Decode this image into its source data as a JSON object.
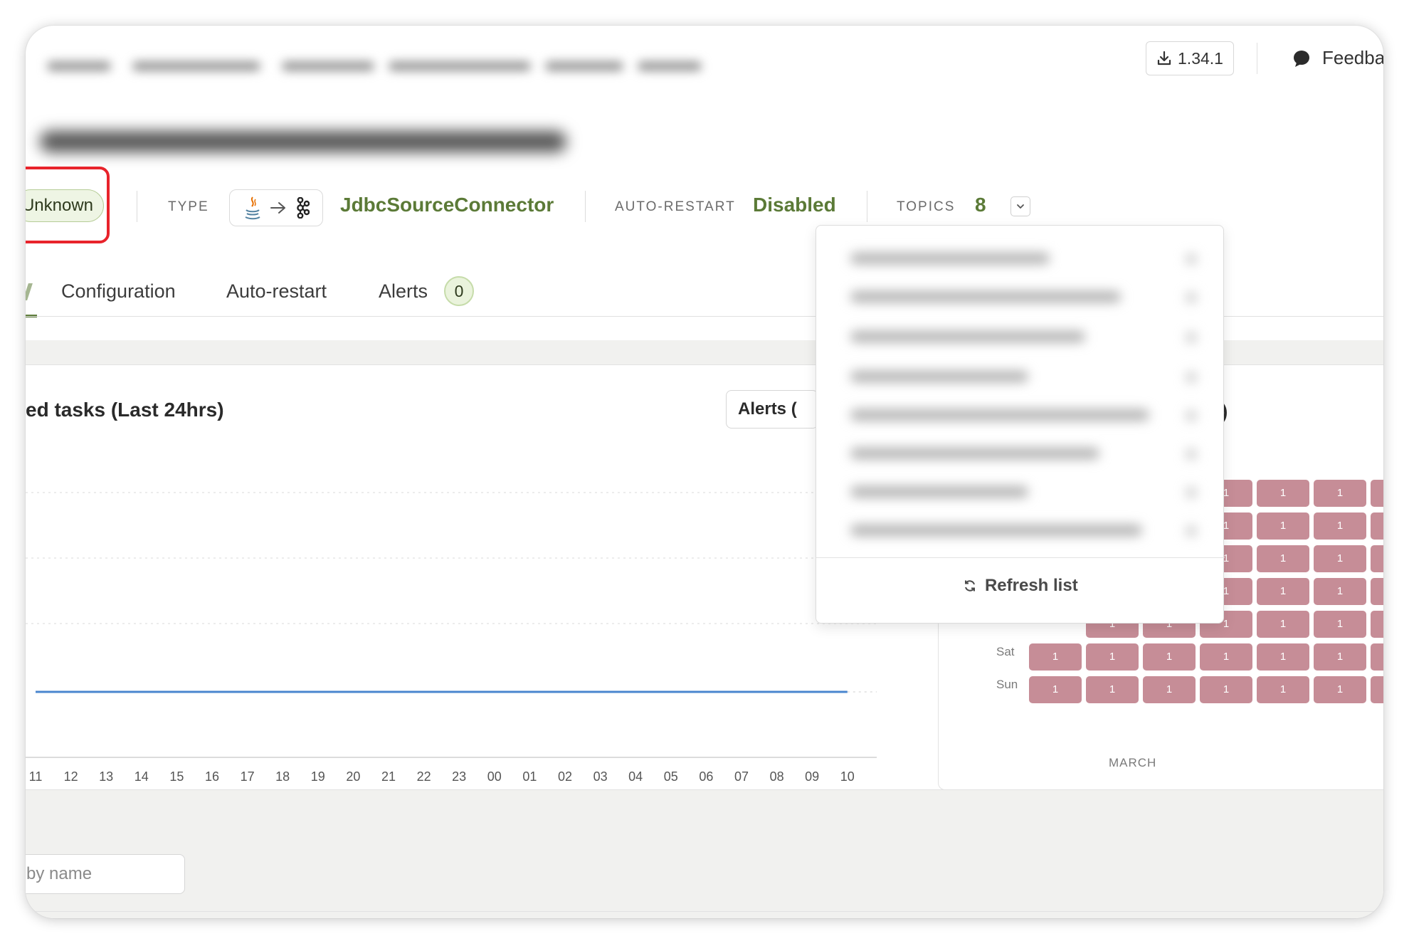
{
  "header": {
    "version": "1.34.1",
    "feedback_label": "Feedba"
  },
  "status": {
    "state": "Unknown",
    "type_label": "TYPE",
    "connector_class": "JdbcSourceConnector",
    "auto_restart_label": "AUTO-RESTART",
    "auto_restart_value": "Disabled",
    "topics_label": "TOPICS",
    "topics_count": "8"
  },
  "tabs": [
    {
      "label": "Configuration"
    },
    {
      "label": "Auto-restart"
    },
    {
      "label": "Alerts",
      "badge": "0"
    }
  ],
  "chart_card": {
    "title": "ed tasks (Last 24hrs)",
    "filter_label": "Alerts (",
    "hours": [
      "11",
      "12",
      "13",
      "14",
      "15",
      "16",
      "17",
      "18",
      "19",
      "20",
      "21",
      "22",
      "23",
      "00",
      "01",
      "02",
      "03",
      "04",
      "05",
      "06",
      "07",
      "08",
      "09",
      "10"
    ]
  },
  "chart_data": {
    "type": "line",
    "x": [
      "11",
      "12",
      "13",
      "14",
      "15",
      "16",
      "17",
      "18",
      "19",
      "20",
      "21",
      "22",
      "23",
      "00",
      "01",
      "02",
      "03",
      "04",
      "05",
      "06",
      "07",
      "08",
      "09",
      "10"
    ],
    "series": [
      {
        "values": [
          0,
          0,
          0,
          0,
          0,
          0,
          0,
          0,
          0,
          0,
          0,
          0,
          0,
          0,
          0,
          0,
          0,
          0,
          0,
          0,
          0,
          0,
          0,
          0
        ]
      }
    ],
    "grid": "horizontal dotted",
    "colors": {
      "line": "#4a86cf"
    }
  },
  "heatmap_card": {
    "title_tail": ")",
    "days": [
      "Sat",
      "Sun"
    ],
    "cell_value": "1",
    "month": "MARCH",
    "cell_color": "#c68d97"
  },
  "search": {
    "placeholder": "by name"
  },
  "dropdown": {
    "refresh_label": "Refresh list"
  },
  "colors": {
    "accent_green": "#5b7a37",
    "highlight_red": "#e8232b"
  }
}
